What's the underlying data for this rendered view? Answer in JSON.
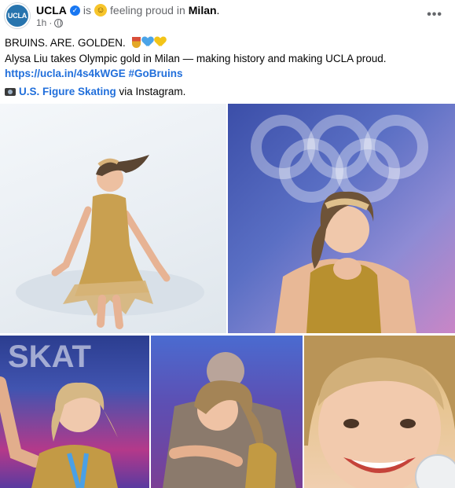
{
  "post": {
    "avatar_text": "UCLA",
    "author": "UCLA",
    "is_text": "is",
    "feeling_text": "feeling proud in",
    "location": "Milan",
    "period": ".",
    "time": "1h",
    "dot": "·",
    "more_icon": "•••",
    "headline": "BRUINS. ARE. GOLDEN.",
    "body": "Alysa Liu takes Olympic gold in Milan — making history and making UCLA proud.",
    "link_url": "https://ucla.in/4s4kWGE",
    "hashtag": "#GoBruins",
    "credit_name": "U.S. Figure Skating",
    "credit_suffix": "via Instagram."
  },
  "icons": [
    "ucla-avatar-icon",
    "verified-icon",
    "smiling-emoji-icon",
    "globe-icon",
    "more-icon",
    "medal-icon",
    "blue-heart-icon",
    "yellow-heart-icon",
    "camera-icon"
  ],
  "colors": {
    "link": "#216fdb",
    "verified": "#1877f2",
    "muted": "#65676b",
    "brand": "#2774ae"
  }
}
